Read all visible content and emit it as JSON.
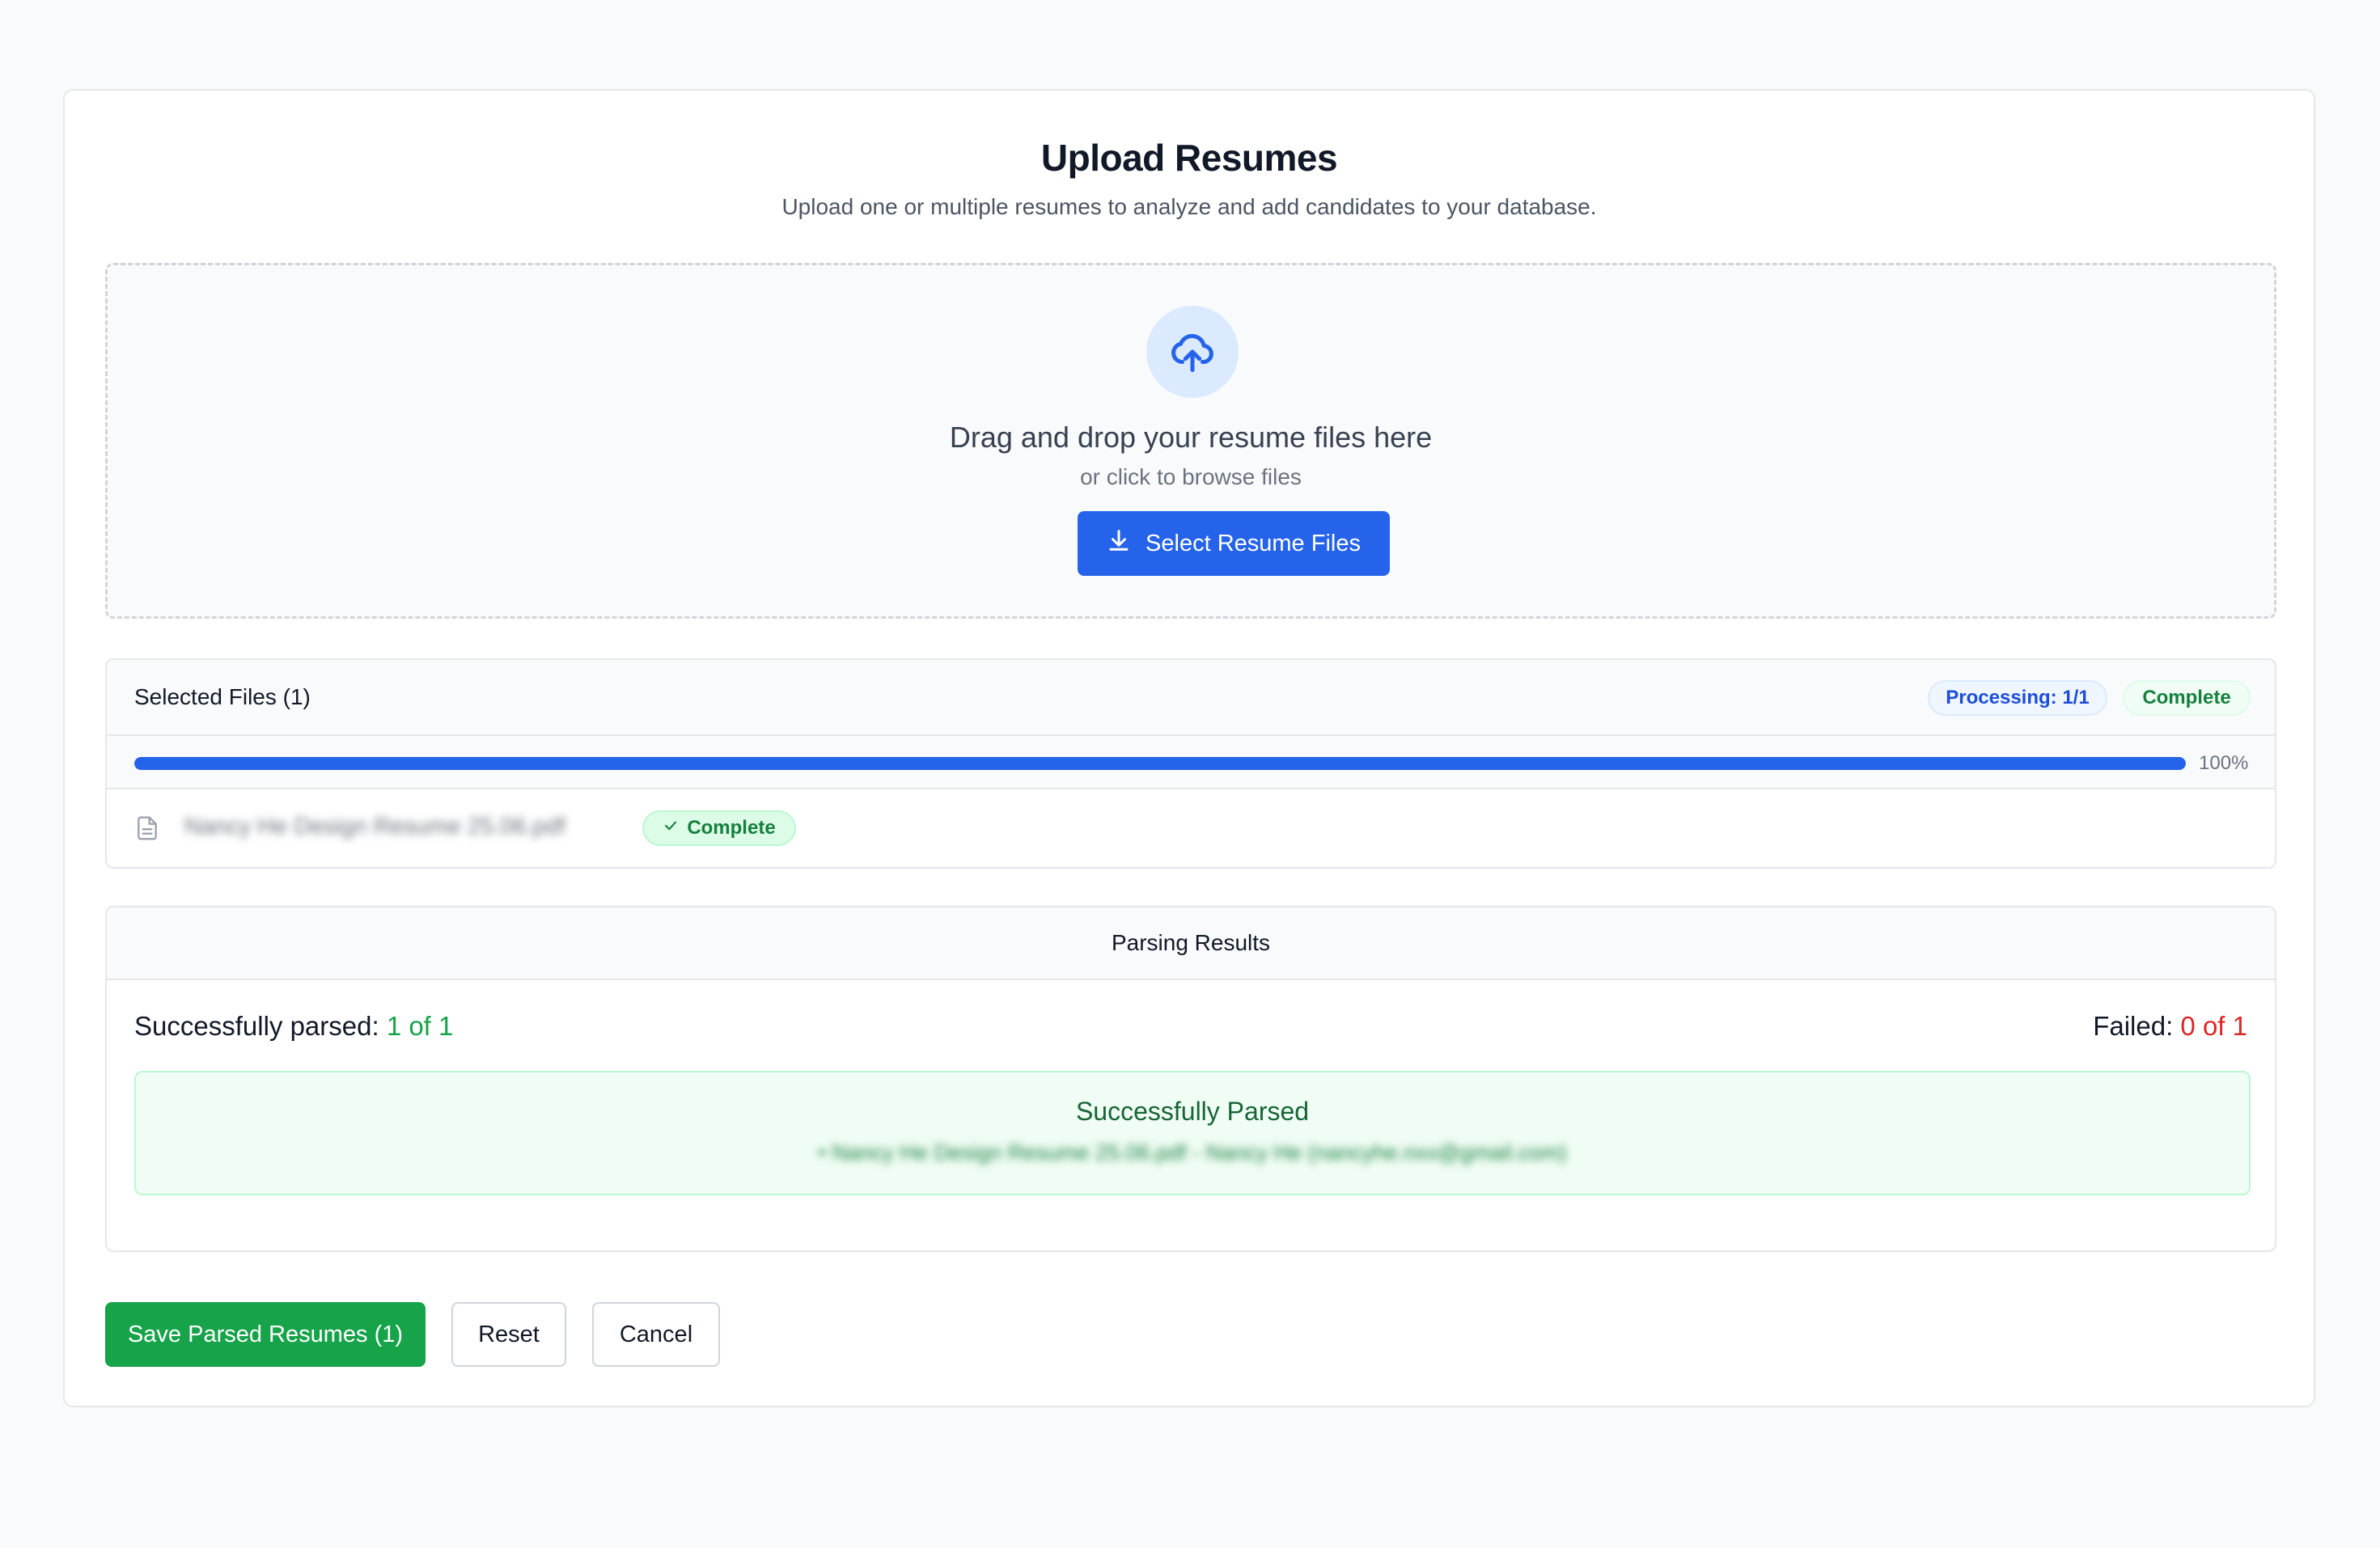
{
  "header": {
    "title": "Upload Resumes",
    "subtitle": "Upload one or multiple resumes to analyze and add candidates to your database."
  },
  "dropzone": {
    "icon": "cloud-upload-icon",
    "title": "Drag and drop your resume files here",
    "subtitle": "or click to browse files",
    "button_label": "Select Resume Files",
    "button_icon": "download-icon"
  },
  "selected_files": {
    "title": "Selected Files (1)",
    "processing_badge": "Processing: 1/1",
    "status_badge": "Complete",
    "progress_percent": 100,
    "progress_label": "100%",
    "files": [
      {
        "name": "Nancy He Design Resume 25.06.pdf",
        "status": "Complete",
        "icon": "file-icon"
      }
    ]
  },
  "parsing_results": {
    "title": "Parsing Results",
    "success_label": "Successfully parsed:",
    "success_value": "1 of 1",
    "failed_label": "Failed:",
    "failed_value": "0 of 1",
    "success_box_title": "Successfully Parsed",
    "success_items": [
      "• Nancy He Design Resume 25.06.pdf - Nancy He (nancyhe.nxx@gmail.com)"
    ]
  },
  "actions": {
    "save_label": "Save Parsed Resumes (1)",
    "reset_label": "Reset",
    "cancel_label": "Cancel"
  },
  "colors": {
    "primary": "#2563eb",
    "success": "#16a34a",
    "danger": "#dc2626"
  }
}
